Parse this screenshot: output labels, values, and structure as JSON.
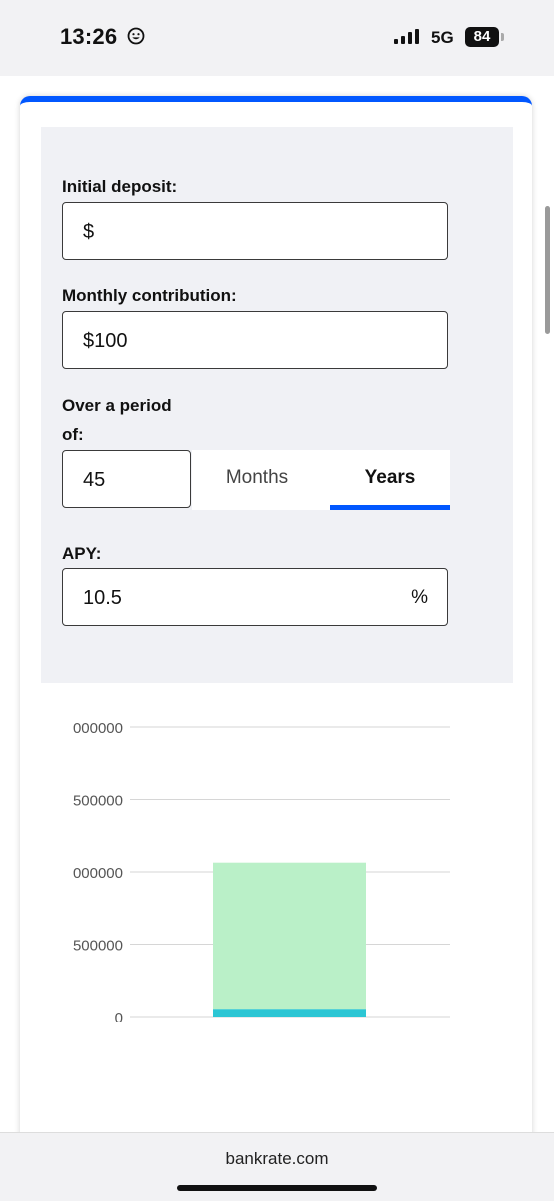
{
  "status_bar": {
    "time": "13:26",
    "network": "5G",
    "battery": "84",
    "icons": [
      "smiley-icon",
      "signal-icon",
      "battery-icon"
    ]
  },
  "form": {
    "initial_deposit": {
      "label": "Initial deposit:",
      "value": "$"
    },
    "monthly_contribution": {
      "label": "Monthly contribution:",
      "value": "$100"
    },
    "period": {
      "label_line1": "Over a period",
      "label_line2": "of:",
      "value": "45",
      "units": [
        "Months",
        "Years"
      ],
      "selected_unit": "Years"
    },
    "apy": {
      "label": "APY:",
      "value": "10.5",
      "suffix": "%"
    }
  },
  "chart_data": {
    "type": "bar",
    "categories": [
      ""
    ],
    "y_tick_labels": [
      "000000",
      "500000",
      "000000",
      "500000",
      "0"
    ],
    "ylim": [
      0,
      2000000
    ],
    "series": [
      {
        "values": [
          54100
        ],
        "color": "#2cc6d4"
      },
      {
        "values": [
          1010000
        ],
        "color": "#baf0c8"
      }
    ],
    "grid": true
  },
  "browser": {
    "url": "bankrate.com"
  },
  "colors": {
    "accent": "#0157ff",
    "panel_bg": "#f0f1f5"
  }
}
